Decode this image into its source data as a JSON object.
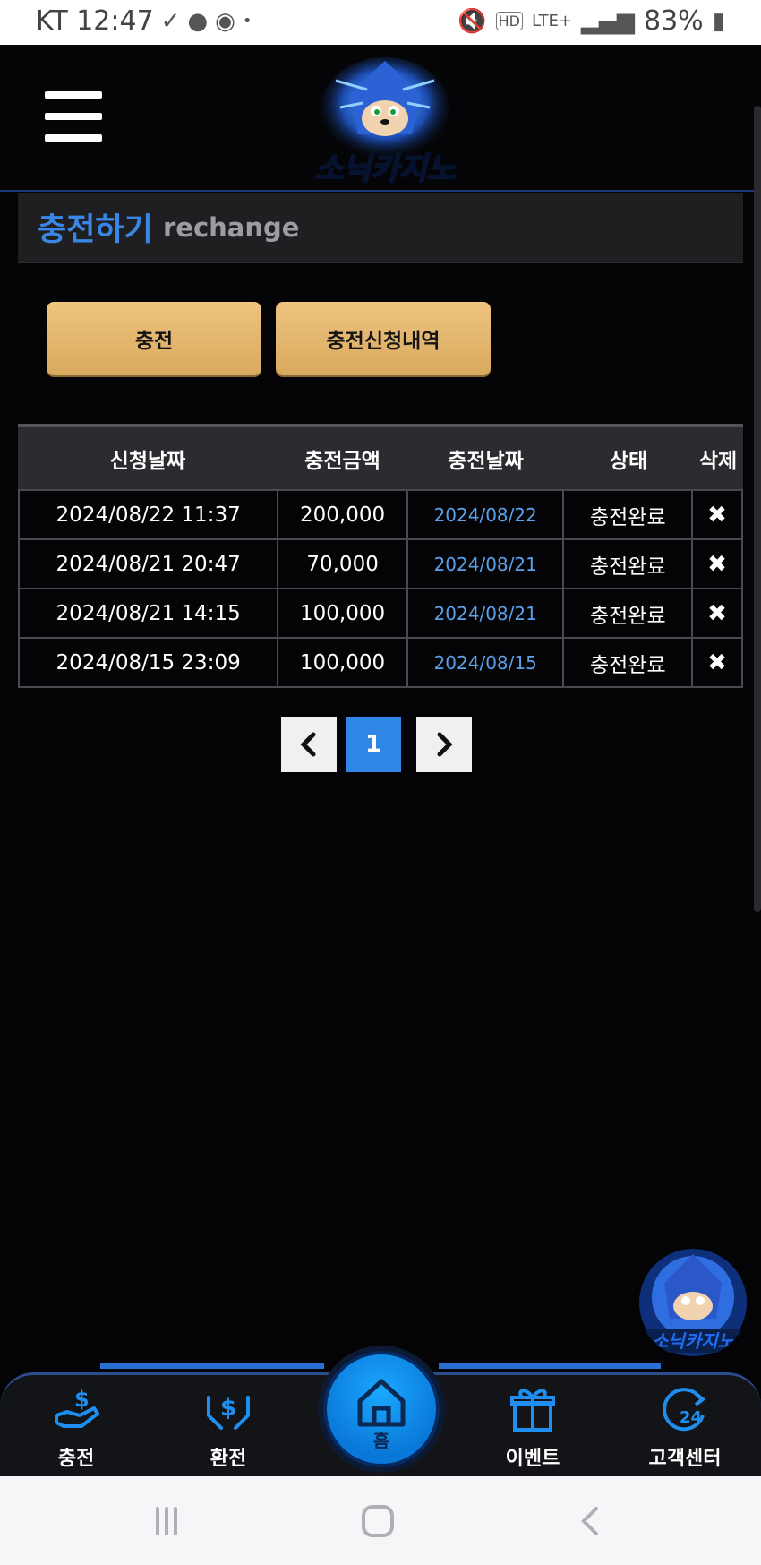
{
  "status_bar": {
    "carrier_time": "KT 12:47",
    "battery": "83%",
    "network": "LTE+"
  },
  "header": {
    "brand": "소닉카지노"
  },
  "section": {
    "title": "충전하기",
    "subtitle": "rechange"
  },
  "actions": {
    "charge_label": "충전",
    "history_label": "충전신청내역"
  },
  "table": {
    "headers": [
      "신청날짜",
      "충전금액",
      "충전날짜",
      "상태",
      "삭제"
    ],
    "rows": [
      {
        "requested": "2024/08/22 11:37",
        "amount": "200,000",
        "charged": "2024/08/22",
        "status": "충전완료"
      },
      {
        "requested": "2024/08/21 20:47",
        "amount": "70,000",
        "charged": "2024/08/21",
        "status": "충전완료"
      },
      {
        "requested": "2024/08/21 14:15",
        "amount": "100,000",
        "charged": "2024/08/21",
        "status": "충전완료"
      },
      {
        "requested": "2024/08/15 23:09",
        "amount": "100,000",
        "charged": "2024/08/15",
        "status": "충전완료"
      }
    ],
    "delete_glyph": "✖"
  },
  "pagination": {
    "prev": "‹",
    "current": "1",
    "next": "›"
  },
  "bottom_nav": {
    "items": [
      {
        "label": "충전",
        "icon": "deposit-hand-icon"
      },
      {
        "label": "환전",
        "icon": "exchange-hand-icon"
      },
      {
        "label": "홈",
        "icon": "home-icon"
      },
      {
        "label": "이벤트",
        "icon": "gift-icon"
      },
      {
        "label": "고객센터",
        "icon": "support-24-icon"
      }
    ]
  },
  "colors": {
    "accent_blue": "#3a86e6",
    "gold_button": "#e6b86c",
    "date_blue": "#5ba0ea",
    "page_active": "#2f86e4"
  }
}
